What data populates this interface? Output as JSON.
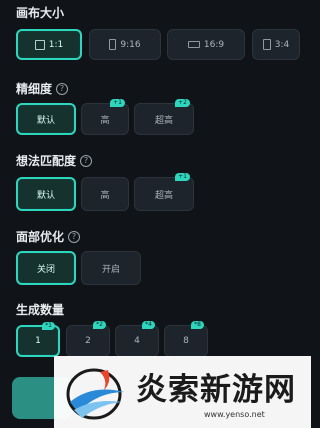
{
  "canvas": {
    "title": "画布大小",
    "options": [
      {
        "label": "1:1",
        "selected": true
      },
      {
        "label": "9:16",
        "selected": false
      },
      {
        "label": "16:9",
        "selected": false
      },
      {
        "label": "3:4",
        "selected": false
      }
    ]
  },
  "detail": {
    "title": "精细度",
    "options": [
      {
        "label": "默认",
        "selected": true,
        "badge": ""
      },
      {
        "label": "高",
        "selected": false,
        "badge": "+1"
      },
      {
        "label": "超高",
        "selected": false,
        "badge": "+2"
      }
    ]
  },
  "match": {
    "title": "想法匹配度",
    "options": [
      {
        "label": "默认",
        "selected": true,
        "badge": ""
      },
      {
        "label": "高",
        "selected": false,
        "badge": ""
      },
      {
        "label": "超高",
        "selected": false,
        "badge": "+1"
      }
    ]
  },
  "face": {
    "title": "面部优化",
    "options": [
      {
        "label": "关闭",
        "selected": true
      },
      {
        "label": "开启",
        "selected": false
      }
    ]
  },
  "count": {
    "title": "生成数量",
    "options": [
      {
        "label": "1",
        "selected": true,
        "badge": "*1"
      },
      {
        "label": "2",
        "selected": false,
        "badge": "*2"
      },
      {
        "label": "4",
        "selected": false,
        "badge": "*4"
      },
      {
        "label": "8",
        "selected": false,
        "badge": "*8"
      }
    ]
  },
  "watermark": {
    "title": "炎索新游网",
    "url": "www.yenso.net"
  },
  "colors": {
    "accent": "#2fd6be",
    "background": "#101418",
    "tile": "#1e242b"
  },
  "icons": {
    "help": "question-circle-icon",
    "ratio": "aspect-ratio-icon"
  }
}
